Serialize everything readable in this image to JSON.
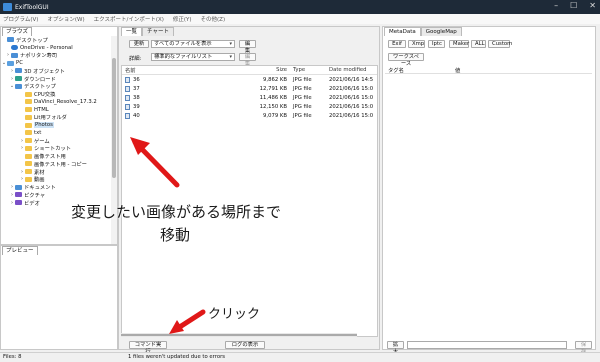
{
  "window": {
    "title": "ExifToolGUI"
  },
  "menu": [
    "プログラム(V)",
    "オプション(W)",
    "エクスポート/インポート(X)",
    "修正(Y)",
    "その他(Z)"
  ],
  "browse": {
    "tab": "ブラウズ",
    "tree": [
      {
        "label": "デスクトップ",
        "icon": "blue"
      },
      {
        "label": "OneDrive - Personal",
        "icon": "cloud"
      },
      {
        "label": "ナポリタン寿司",
        "icon": "blue"
      },
      {
        "label": "PC",
        "icon": "pc"
      },
      {
        "label": "3D オブジェクト",
        "icon": "blue"
      },
      {
        "label": "ダウンロード",
        "icon": "teal"
      },
      {
        "label": "デスクトップ",
        "icon": "blue"
      },
      {
        "label": "CPU交換",
        "icon": "yellow"
      },
      {
        "label": "DaVinci_Resolve_17.3.2",
        "icon": "yellow"
      },
      {
        "label": "HTML",
        "icon": "yellow"
      },
      {
        "label": "Lit用フォルダ",
        "icon": "yellow"
      },
      {
        "label": "Photos",
        "icon": "yellow"
      },
      {
        "label": "txt",
        "icon": "yellow"
      },
      {
        "label": "ゲーム",
        "icon": "yellow"
      },
      {
        "label": "ショートカット",
        "icon": "yellow"
      },
      {
        "label": "画像テスト用",
        "icon": "yellow"
      },
      {
        "label": "画像テスト用 - コピー",
        "icon": "yellow"
      },
      {
        "label": "素材",
        "icon": "yellow"
      },
      {
        "label": "動画",
        "icon": "yellow"
      },
      {
        "label": "ドキュメント",
        "icon": "blue"
      },
      {
        "label": "ピクチャ",
        "icon": "purple"
      },
      {
        "label": "ビデオ",
        "icon": "purple"
      }
    ]
  },
  "preview": {
    "tab": "プレビュー"
  },
  "filelist": {
    "tabs": [
      "一覧",
      "チャート"
    ],
    "refresh": "更新",
    "filter": "すべてのファイルを表示",
    "edit1": "編集",
    "details": "詳細:",
    "view": "標準的なファイルリスト",
    "edit2": "編集",
    "columns": {
      "name": "名前",
      "size": "Size",
      "type": "Type",
      "date": "Date modified"
    },
    "files": [
      {
        "name": "36",
        "size": "9,862 KB",
        "type": "JPG file",
        "date": "2021/06/16 14:5"
      },
      {
        "name": "37",
        "size": "12,791 KB",
        "type": "JPG file",
        "date": "2021/06/16 15:0"
      },
      {
        "name": "38",
        "size": "11,486 KB",
        "type": "JPG file",
        "date": "2021/06/16 15:0"
      },
      {
        "name": "39",
        "size": "12,150 KB",
        "type": "JPG file",
        "date": "2021/06/16 15:0"
      },
      {
        "name": "40",
        "size": "9,079 KB",
        "type": "JPG file",
        "date": "2021/06/16 15:0"
      }
    ],
    "cmd_button": "コマンド実行",
    "log_button": "ログの表示"
  },
  "metadata": {
    "tabs": [
      "MetaData",
      "GoogleMap"
    ],
    "filters": [
      "Exif",
      "Xmp",
      "Iptc",
      "Maker",
      "ALL",
      "Custom"
    ],
    "workspace": "ワークスペース",
    "col_tag": "タグ名",
    "col_value": "値",
    "expand": "拡大",
    "save": "保存"
  },
  "annotations": {
    "main": "変更したい画像がある場所まで",
    "sub": "移動",
    "click": "クリック"
  },
  "status": {
    "files": "Files: 8",
    "message": "1 files weren't updated due to errors"
  }
}
